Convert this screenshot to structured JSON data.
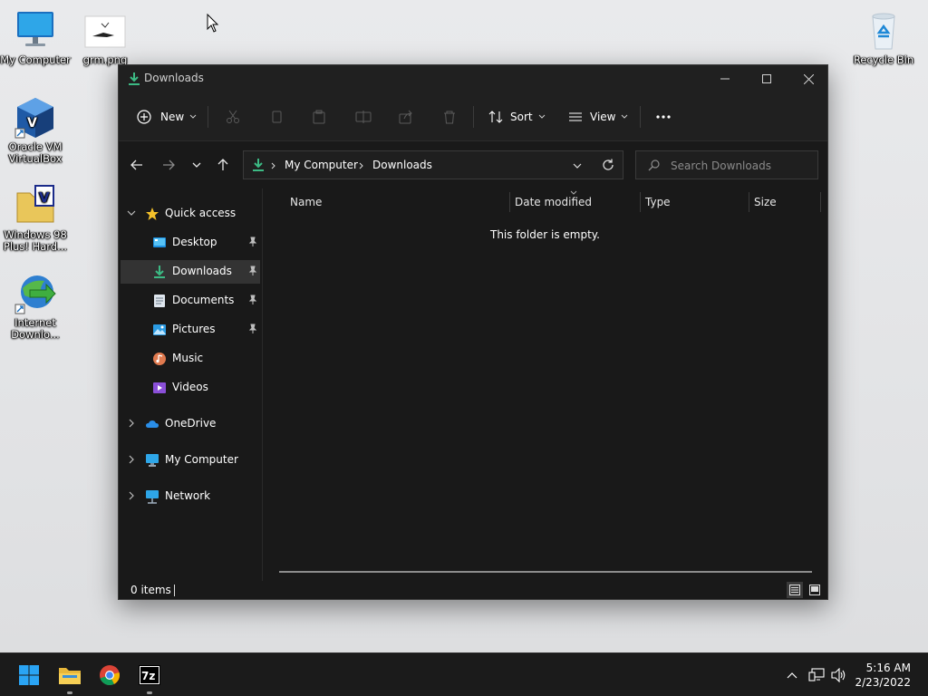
{
  "desktop": {
    "icons": [
      {
        "label": "My Computer"
      },
      {
        "label": "grm.png"
      },
      {
        "label": "Recycle Bin"
      },
      {
        "label": "Oracle VM VirtualBox"
      },
      {
        "label": "Windows 98 Plus! Hard..."
      },
      {
        "label": "Internet Downlo..."
      }
    ]
  },
  "window": {
    "title": "Downloads",
    "toolbar": {
      "new_label": "New",
      "sort_label": "Sort",
      "view_label": "View"
    },
    "address": {
      "crumbs": [
        "My Computer",
        "Downloads"
      ]
    },
    "search": {
      "placeholder": "Search Downloads"
    },
    "sidebar": {
      "quick_access": "Quick access",
      "items": [
        {
          "label": "Desktop"
        },
        {
          "label": "Downloads"
        },
        {
          "label": "Documents"
        },
        {
          "label": "Pictures"
        },
        {
          "label": "Music"
        },
        {
          "label": "Videos"
        }
      ],
      "onedrive": "OneDrive",
      "my_computer": "My Computer",
      "network": "Network"
    },
    "columns": [
      "Name",
      "Date modified",
      "Type",
      "Size"
    ],
    "empty_message": "This folder is empty.",
    "status": {
      "item_count": "0 items"
    }
  },
  "taskbar": {
    "time": "5:16 AM",
    "date": "2/23/2022"
  },
  "colors": {
    "accent_green": "#3cba84",
    "window_bg": "#191919",
    "taskbar_bg": "#1b1b1b"
  }
}
